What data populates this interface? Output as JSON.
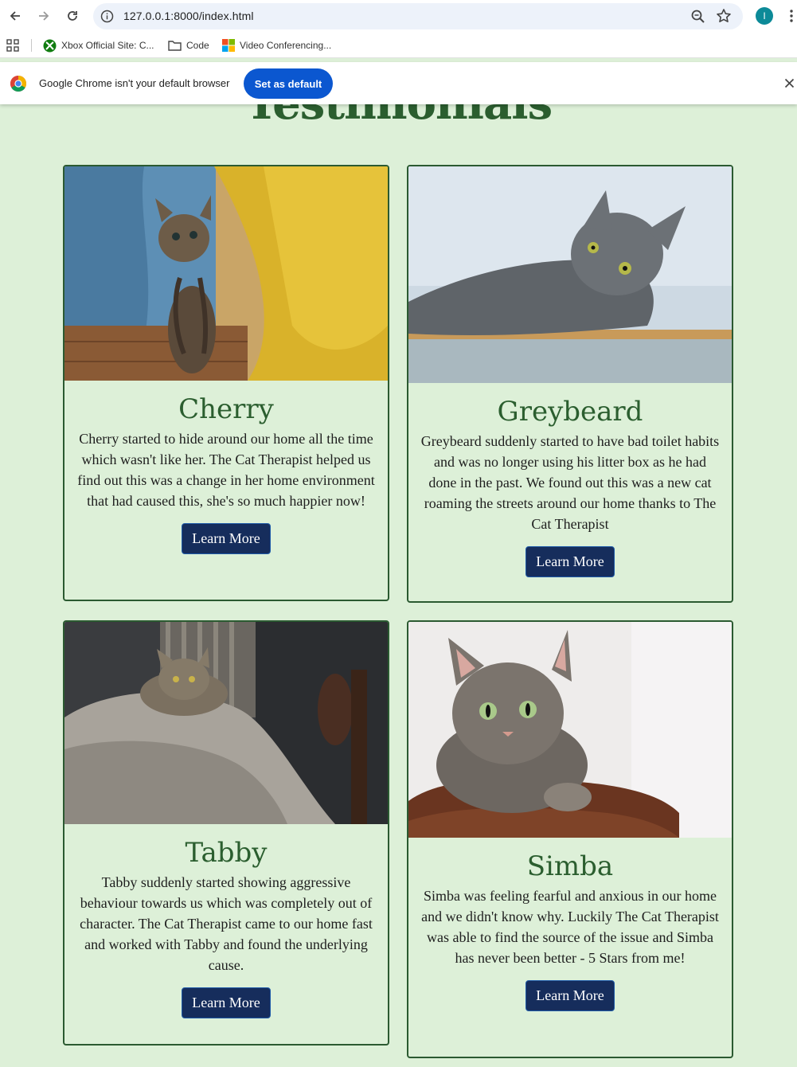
{
  "browser": {
    "url": "127.0.0.1:8000/index.html",
    "profile_initial": "I",
    "bookmarks": [
      {
        "label": "Xbox Official Site: C...",
        "icon": "xbox-icon"
      },
      {
        "label": "Code",
        "icon": "folder-icon"
      },
      {
        "label": "Video Conferencing...",
        "icon": "microsoft-icon"
      }
    ],
    "infobar": {
      "message": "Google Chrome isn't your default browser",
      "button_label": "Set as default"
    }
  },
  "page": {
    "title": "Testimonials",
    "testimonials": [
      {
        "name": "Cherry",
        "text": "Cherry started to hide around our home all the time which wasn't like her. The Cat Therapist helped us find out this was a change in her home environment that had caused this, she's so much happier now!",
        "button_label": "Learn More"
      },
      {
        "name": "Greybeard",
        "text": "Greybeard suddenly started to have bad toilet habits and was no longer using his litter box as he had done in the past. We found out this was a new cat roaming the streets around our home thanks to The Cat Therapist",
        "button_label": "Learn More"
      },
      {
        "name": "Tabby",
        "text": "Tabby suddenly started showing aggressive behaviour towards us which was completely out of character. The Cat Therapist came to our home fast and worked with Tabby and found the underlying cause.",
        "button_label": "Learn More"
      },
      {
        "name": "Simba",
        "text": "Simba was feeling fearful and anxious in our home and we didn't know why. Luckily The Cat Therapist was able to find the source of the issue and Simba has never been better - 5 Stars from me!",
        "button_label": "Learn More"
      }
    ]
  },
  "colors": {
    "page_background": "#ddf0d8",
    "heading_green": "#2b5e2f",
    "button_navy": "#162d5c",
    "chrome_blue": "#0b57d0"
  }
}
